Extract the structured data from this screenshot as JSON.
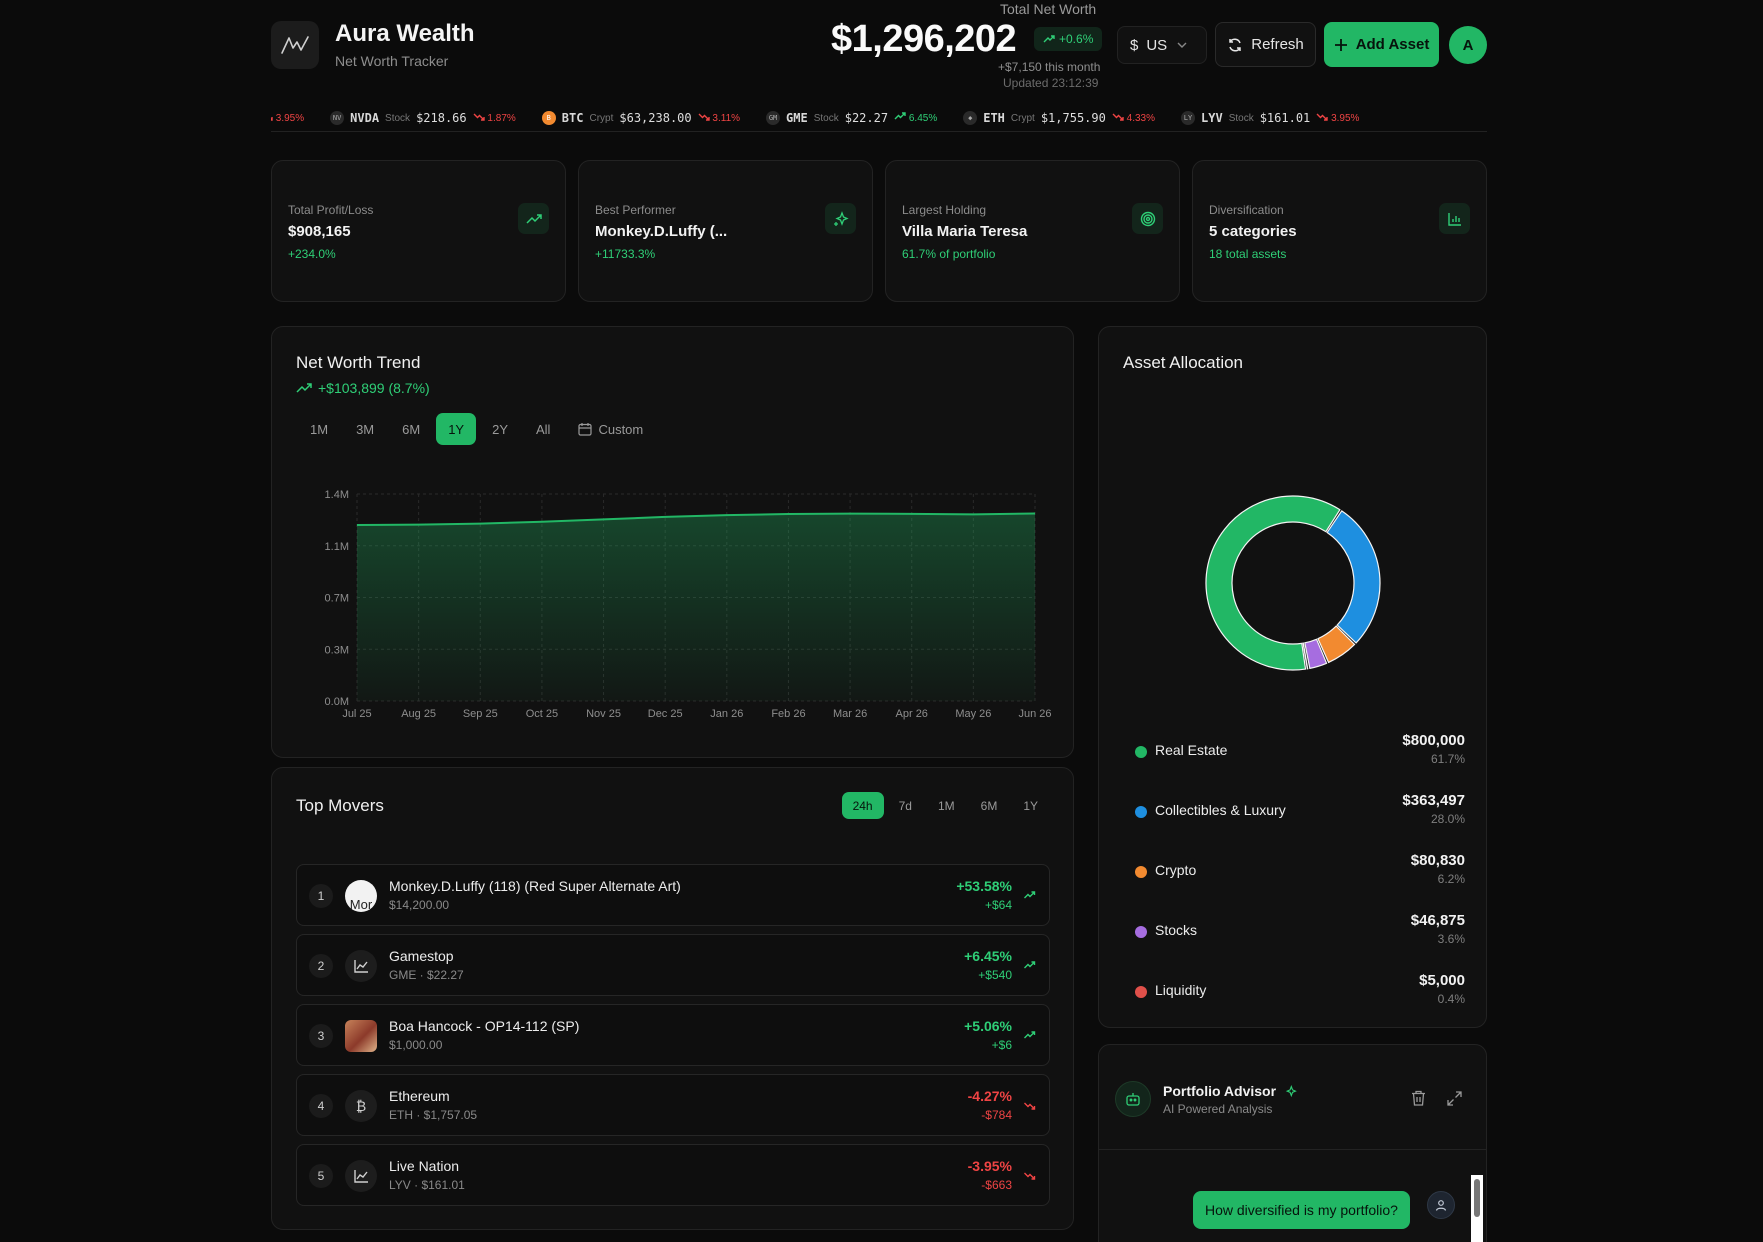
{
  "brand": {
    "title": "Aura Wealth",
    "subtitle": "Net Worth Tracker"
  },
  "networth": {
    "label": "Total Net Worth",
    "value": "$1,296,202",
    "change": "+0.6%",
    "month": "+$7,150 this month",
    "updated": "Updated 23:12:39"
  },
  "header": {
    "currency_symbol": "$",
    "currency": "USD",
    "refresh_label": "Refresh",
    "add_label": "Add Asset",
    "avatar_initial": "A"
  },
  "ticker": [
    {
      "icon": "",
      "symbol": "",
      "type": "",
      "price": "",
      "change": "3.95%",
      "dir": "down"
    },
    {
      "icon": "NV",
      "symbol": "NVDA",
      "type": "Stock",
      "price": "$218.66",
      "change": "1.87%",
      "dir": "down"
    },
    {
      "icon": "B",
      "symbol": "BTC",
      "type": "Crypt",
      "price": "$63,238.00",
      "change": "3.11%",
      "dir": "down"
    },
    {
      "icon": "GM",
      "symbol": "GME",
      "type": "Stock",
      "price": "$22.27",
      "change": "6.45%",
      "dir": "up"
    },
    {
      "icon": "◆",
      "symbol": "ETH",
      "type": "Crypt",
      "price": "$1,755.90",
      "change": "4.33%",
      "dir": "down"
    },
    {
      "icon": "LY",
      "symbol": "LYV",
      "type": "Stock",
      "price": "$161.01",
      "change": "3.95%",
      "dir": "down"
    }
  ],
  "stats": [
    {
      "label": "Total Profit/Loss",
      "value": "$908,165",
      "sub": "+234.0%",
      "icon": "trending-up-icon"
    },
    {
      "label": "Best Performer",
      "value": "Monkey.D.Luffy (...",
      "sub": "+11733.3%",
      "icon": "sparkles-icon"
    },
    {
      "label": "Largest Holding",
      "value": "Villa Maria Teresa",
      "sub": "61.7% of portfolio",
      "icon": "target-icon"
    },
    {
      "label": "Diversification",
      "value": "5 categories",
      "sub": "18 total assets",
      "icon": "bar-chart-icon"
    }
  ],
  "trend": {
    "title": "Net Worth Trend",
    "change": "+$103,899 (8.7%)",
    "ranges": [
      "1M",
      "3M",
      "6M",
      "1Y",
      "2Y",
      "All"
    ],
    "active_range": "1Y",
    "custom_label": "Custom"
  },
  "chart_data": {
    "type": "area",
    "x": [
      "Jul 25",
      "Aug 25",
      "Sep 25",
      "Oct 25",
      "Nov 25",
      "Dec 25",
      "Jan 26",
      "Feb 26",
      "Mar 26",
      "Apr 26",
      "May 26",
      "Jun 26"
    ],
    "values": [
      1190000,
      1193000,
      1200000,
      1212000,
      1228000,
      1245000,
      1257000,
      1265000,
      1267000,
      1266000,
      1262000,
      1268000
    ],
    "yticks": [
      "0.0M",
      "0.3M",
      "0.7M",
      "1.1M",
      "1.4M"
    ],
    "ylim": [
      0,
      1400000
    ],
    "grid": true,
    "color": "#22b765"
  },
  "movers": {
    "title": "Top Movers",
    "ranges": [
      "24h",
      "7d",
      "1M",
      "6M",
      "1Y"
    ],
    "active_range": "24h",
    "rows": [
      {
        "rank": "1",
        "name": "Monkey.D.Luffy (118) (Red Super Alternate Art)",
        "meta": "$14,200.00",
        "pct": "+53.58%",
        "amt": "+$64",
        "dir": "up",
        "thumb": "Mor"
      },
      {
        "rank": "2",
        "name": "Gamestop",
        "meta": "GME · $22.27",
        "pct": "+6.45%",
        "amt": "+$540",
        "dir": "up",
        "thumb": ""
      },
      {
        "rank": "3",
        "name": "Boa Hancock - OP14-112 (SP)",
        "meta": "$1,000.00",
        "pct": "+5.06%",
        "amt": "+$6",
        "dir": "up",
        "thumb": ""
      },
      {
        "rank": "4",
        "name": "Ethereum",
        "meta": "ETH · $1,757.05",
        "pct": "-4.27%",
        "amt": "-$784",
        "dir": "down",
        "thumb": "₿"
      },
      {
        "rank": "5",
        "name": "Live Nation",
        "meta": "LYV · $161.01",
        "pct": "-3.95%",
        "amt": "-$663",
        "dir": "down",
        "thumb": ""
      }
    ]
  },
  "allocation": {
    "title": "Asset Allocation",
    "items": [
      {
        "name": "Real Estate",
        "value": "$800,000",
        "pct": "61.7%",
        "share": 61.7,
        "color": "#22b765"
      },
      {
        "name": "Collectibles & Luxury",
        "value": "$363,497",
        "pct": "28.0%",
        "share": 28.0,
        "color": "#1e8fe0"
      },
      {
        "name": "Crypto",
        "value": "$80,830",
        "pct": "6.2%",
        "share": 6.2,
        "color": "#f28a30"
      },
      {
        "name": "Stocks",
        "value": "$46,875",
        "pct": "3.6%",
        "share": 3.6,
        "color": "#a66de0"
      },
      {
        "name": "Liquidity",
        "value": "$5,000",
        "pct": "0.4%",
        "share": 0.4,
        "color": "#e0504a"
      }
    ]
  },
  "advisor": {
    "title": "Portfolio Advisor",
    "subtitle": "AI Powered Analysis",
    "message": "How diversified is my portfolio?"
  }
}
